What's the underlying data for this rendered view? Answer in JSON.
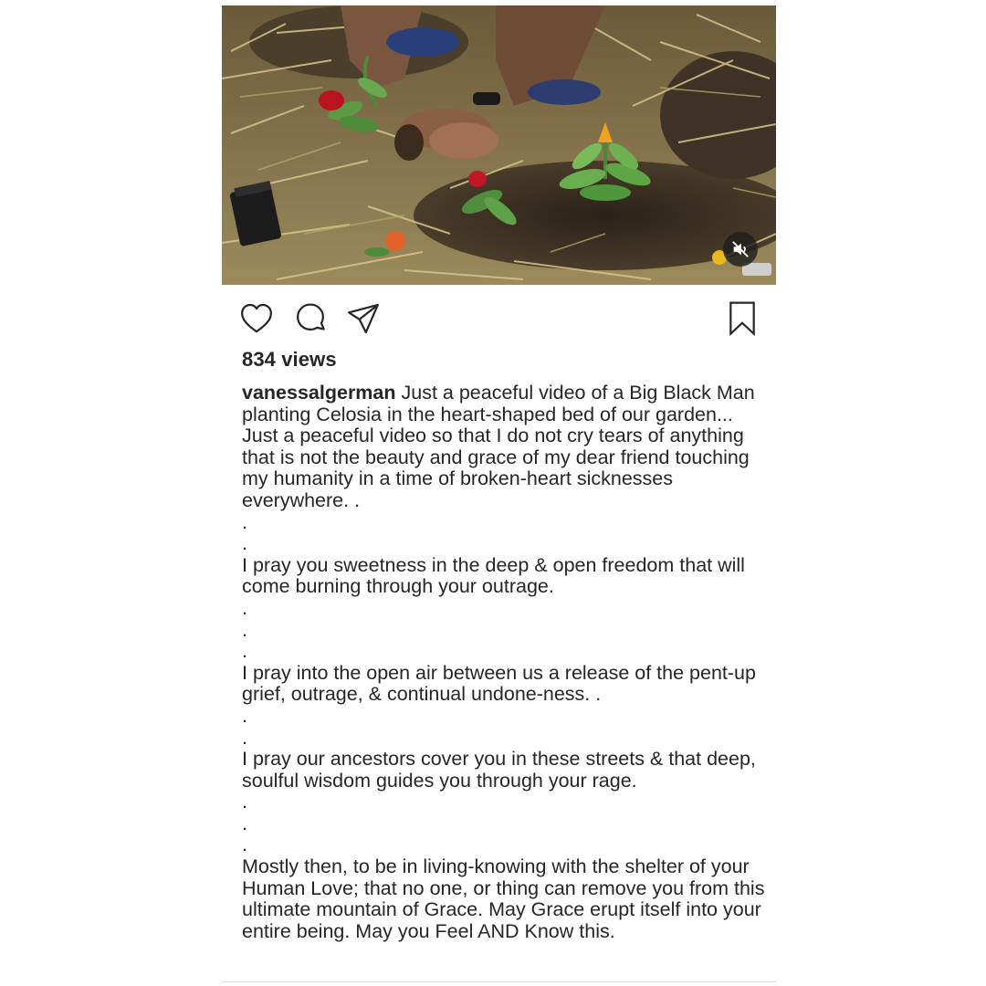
{
  "post": {
    "views": "834 views",
    "username": "vanessalgerman",
    "caption": " Just a peaceful video of a Big Black Man planting Celosia in the heart-shaped bed of our garden... Just a peaceful video so that I do not cry tears of anything that is not the beauty and grace of my dear friend touching my humanity in a time of broken-heart sicknesses everywhere. .\n.\n.\nI pray you sweetness in the deep & open freedom that will come burning through your outrage.\n.\n.\n.\nI pray into the open air between us a release of the pent-up grief, outrage, & continual undone-ness. .\n.\n.\nI pray our ancestors cover you in these streets & that deep, soulful wisdom guides you through your rage.\n.\n.\n.\nMostly then, to be in living-knowing with the shelter of your Human Love; that no one, or thing can remove you from this ultimate mountain of Grace. May Grace erupt itself into your entire being. May you Feel AND Know this."
  },
  "media": {
    "type": "video",
    "sound_icon": "speaker-muted-icon"
  },
  "actions": {
    "like_icon": "heart-icon",
    "comment_icon": "comment-bubble-icon",
    "share_icon": "paper-plane-icon",
    "save_icon": "bookmark-icon"
  },
  "colors": {
    "text": "#262626",
    "background": "#ffffff",
    "mute_button": "#1e1e1e"
  }
}
